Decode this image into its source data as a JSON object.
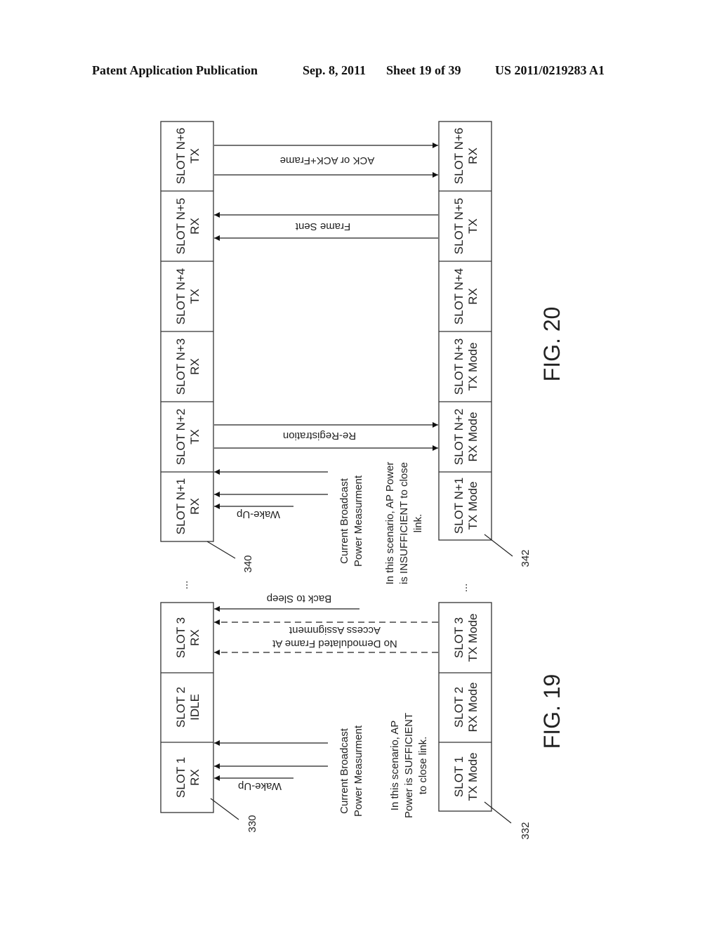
{
  "header": {
    "publication": "Patent Application Publication",
    "date": "Sep. 8, 2011",
    "sheet": "Sheet 19 of 39",
    "number": "US 2011/0219283 A1"
  },
  "fig20": {
    "caption": "FIG. 20",
    "ap_ref": "340",
    "terminal_ref": "342",
    "ap_slots": [
      {
        "line1": "SLOT N+1",
        "line2": "RX"
      },
      {
        "line1": "SLOT N+2",
        "line2": "TX"
      },
      {
        "line1": "SLOT N+3",
        "line2": "RX"
      },
      {
        "line1": "SLOT N+4",
        "line2": "TX"
      },
      {
        "line1": "SLOT N+5",
        "line2": "RX"
      },
      {
        "line1": "SLOT N+6",
        "line2": "TX"
      }
    ],
    "terminal_slots": [
      {
        "line1": "SLOT N+1",
        "line2": "TX Mode"
      },
      {
        "line1": "SLOT N+2",
        "line2": "RX Mode"
      },
      {
        "line1": "SLOT N+3",
        "line2": "TX Mode"
      },
      {
        "line1": "SLOT N+4",
        "line2": "RX"
      },
      {
        "line1": "SLOT N+5",
        "line2": "TX"
      },
      {
        "line1": "SLOT N+6",
        "line2": "RX"
      }
    ],
    "messages": {
      "ack": "ACK or ACK+Frame",
      "frame_sent": "Frame Sent",
      "reregistration": "Re-Registration",
      "wake_up": "Wake-Up",
      "cbpm_line1": "Current Broadcast",
      "cbpm_line2": "Power Measurment",
      "note_line1": "In this scenario, AP Power",
      "note_line2": "is INSUFFICIENT to close",
      "note_line3": "link."
    },
    "ellipsis": "..."
  },
  "fig19": {
    "caption": "FIG. 19",
    "ap_ref": "330",
    "terminal_ref": "332",
    "ap_slots": [
      {
        "line1": "SLOT 1",
        "line2": "RX"
      },
      {
        "line1": "SLOT 2",
        "line2": "IDLE"
      },
      {
        "line1": "SLOT 3",
        "line2": "RX"
      }
    ],
    "terminal_slots": [
      {
        "line1": "SLOT 1",
        "line2": "TX Mode"
      },
      {
        "line1": "SLOT 2",
        "line2": "RX Mode"
      },
      {
        "line1": "SLOT 3",
        "line2": "TX Mode"
      }
    ],
    "messages": {
      "back_to_sleep": "Back to Sleep",
      "no_demod_line1": "No Demodulated Frame At",
      "no_demod_line2": "Access Assignment",
      "wake_up": "Wake-Up",
      "cbpm_line1": "Current Broadcast",
      "cbpm_line2": "Power Measurment",
      "note_line1": "In this scenario, AP",
      "note_line2": "Power is SUFFICIENT",
      "note_line3": "to close link."
    },
    "ellipsis": "..."
  }
}
